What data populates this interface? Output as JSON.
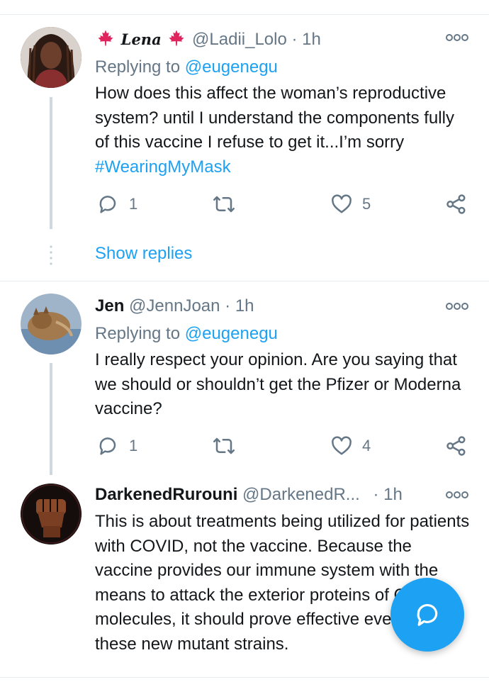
{
  "tweets": [
    {
      "display_name": "Lena",
      "handle": "@Ladii_Lolo",
      "time": "· 1h",
      "replying_label": "Replying to",
      "replying_to": "@eugenegu",
      "text": "How does this affect the woman’s reproductive system? until I understand the components fully of this vaccine I refuse to get it...I’m sorry",
      "hashtag": "#WearingMyMask",
      "reply_count": "1",
      "like_count": "5",
      "show_replies": "Show replies"
    },
    {
      "display_name": "Jen",
      "handle": "@JennJoan",
      "time": "· 1h",
      "replying_label": "Replying to",
      "replying_to": "@eugenegu",
      "text": "I really respect your opinion. Are you saying that we should or shouldn’t get the Pfizer or Moderna vaccine?",
      "reply_count": "1",
      "like_count": "4"
    },
    {
      "display_name": "DarkenedRurouni",
      "handle": "@DarkenedR...",
      "time": "· 1h",
      "text": "This is about treatments being utilized for patients with COVID, not the vaccine. Because the vaccine provides our immune system with the means to attack the exterior proteins of COVID molecules, it should prove effective even against these new mutant strains."
    }
  ],
  "colors": {
    "accent": "#1da1f2",
    "secondary_text": "#657786",
    "maple_leaf": "#e0245e"
  },
  "icons": [
    "maple-leaf-icon",
    "reply-icon",
    "retweet-icon",
    "like-icon",
    "share-icon",
    "more-icon",
    "compose-reply-icon"
  ]
}
